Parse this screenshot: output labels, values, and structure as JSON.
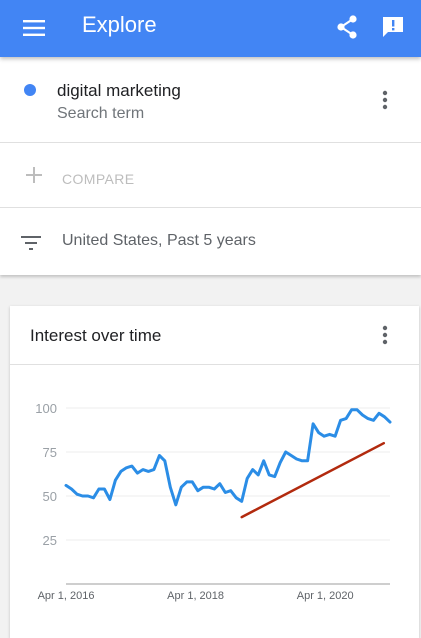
{
  "app": {
    "title": "Explore"
  },
  "colors": {
    "appbar": "#4285f4",
    "series": "#2b8de6",
    "trend": "#b22a0e"
  },
  "icons": {
    "menu": "menu-icon",
    "share": "share-icon",
    "feedback": "feedback-icon",
    "more": "more-vert-icon",
    "add": "add-icon",
    "filter": "filter-icon"
  },
  "search": {
    "term": "digital marketing",
    "subtitle": "Search term",
    "compare_label": "COMPARE",
    "filter_label": "United States, Past 5 years"
  },
  "card": {
    "title": "Interest over time"
  },
  "chart_data": {
    "type": "line",
    "title": "",
    "xlabel": "",
    "ylabel": "",
    "ylim": [
      0,
      100
    ],
    "yticks": [
      25,
      50,
      75,
      100
    ],
    "ytick_labels": [
      "25",
      "50",
      "75",
      "100"
    ],
    "xtick_labels": [
      "Apr 1, 2016",
      "Apr 1, 2018",
      "Apr 1, 2020"
    ],
    "xtick_index": [
      0,
      104,
      208
    ],
    "grid": true,
    "series": [
      {
        "values": [
          56,
          54,
          51,
          50,
          50,
          49,
          54,
          54,
          48,
          59,
          64,
          66,
          67,
          63,
          65,
          64,
          65,
          73,
          70,
          55,
          45,
          55,
          58,
          58,
          53,
          55,
          55,
          54,
          57,
          52,
          53,
          49,
          47,
          60,
          65,
          62,
          70,
          62,
          61,
          69,
          75,
          73,
          71,
          70,
          70,
          91,
          86,
          84,
          85,
          84,
          93,
          94,
          99,
          99,
          96,
          94,
          93,
          97,
          95,
          92
        ]
      },
      {
        "type": "trendline",
        "x_index": [
          141,
          255
        ],
        "values": [
          38,
          80
        ]
      }
    ]
  }
}
